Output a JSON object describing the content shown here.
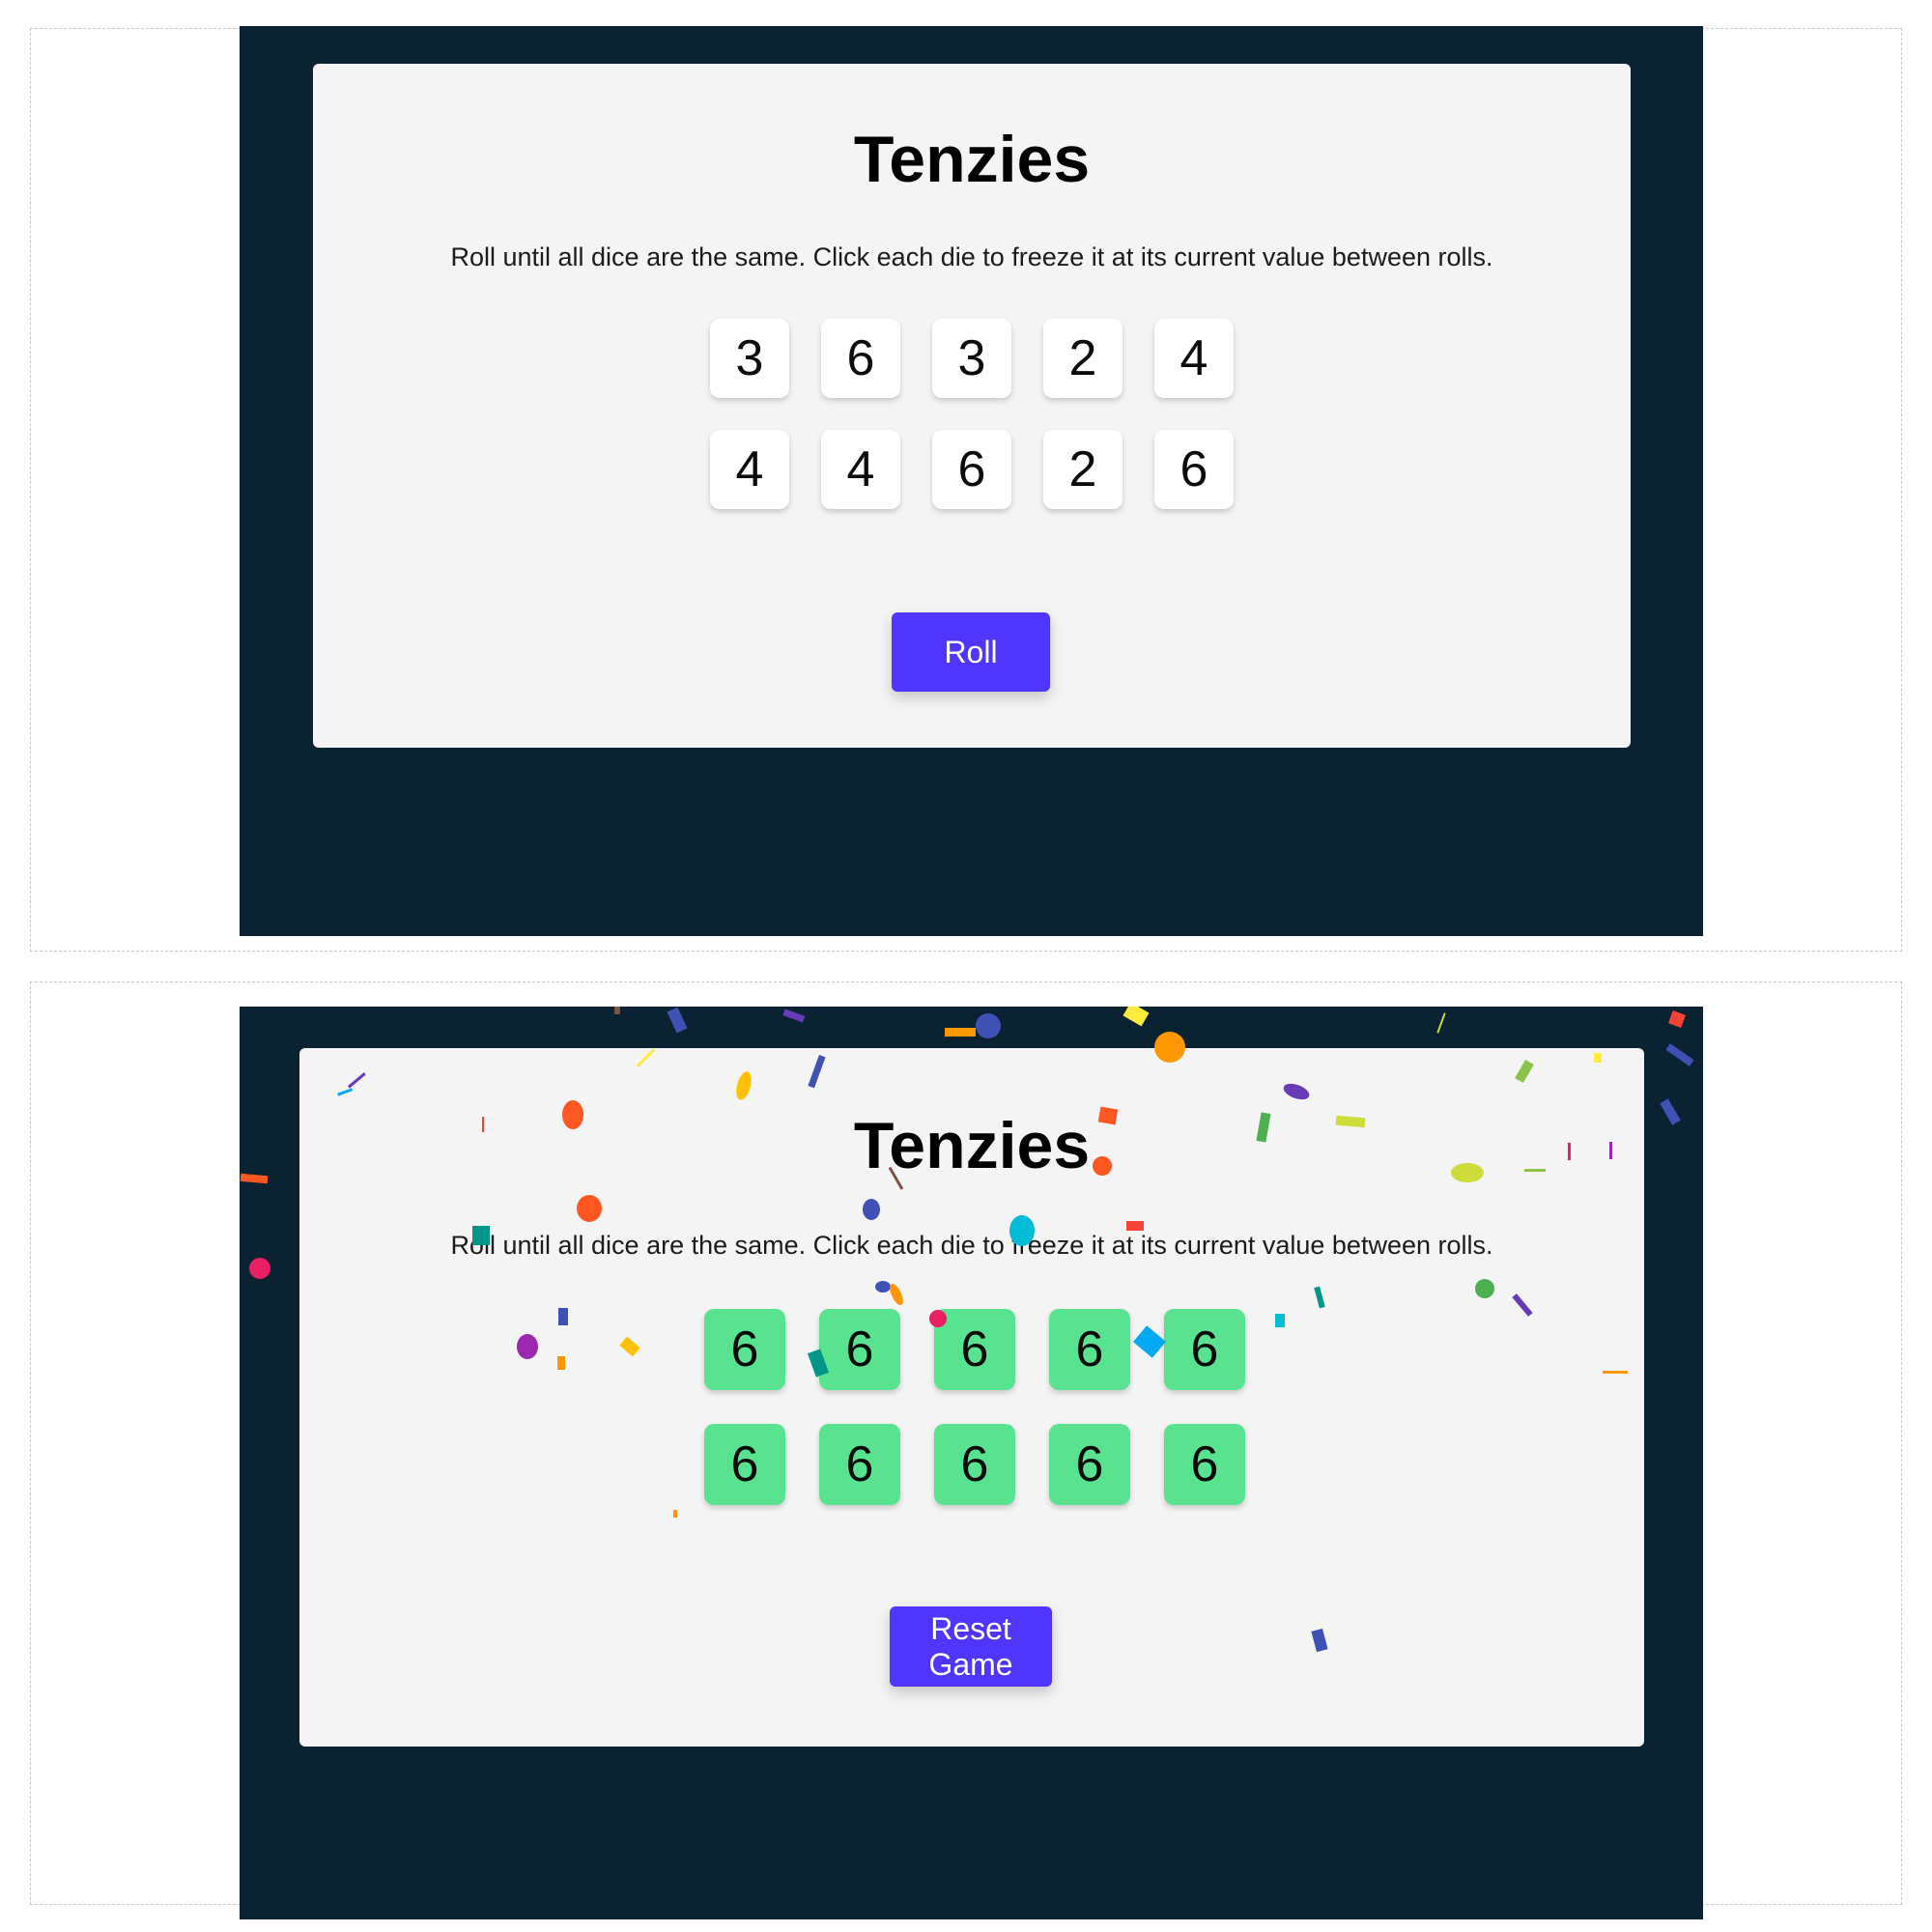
{
  "screens": [
    {
      "title": "Tenzies",
      "instructions": "Roll until all dice are the same. Click each die to freeze it at its current value between rolls.",
      "dice": [
        {
          "value": "3",
          "held": false
        },
        {
          "value": "6",
          "held": false
        },
        {
          "value": "3",
          "held": false
        },
        {
          "value": "2",
          "held": false
        },
        {
          "value": "4",
          "held": false
        },
        {
          "value": "4",
          "held": false
        },
        {
          "value": "4",
          "held": false
        },
        {
          "value": "6",
          "held": false
        },
        {
          "value": "2",
          "held": false
        },
        {
          "value": "6",
          "held": false
        }
      ],
      "button_label": "Roll",
      "confetti": false
    },
    {
      "title": "Tenzies",
      "instructions": "Roll until all dice are the same. Click each die to freeze it at its current value between rolls.",
      "dice": [
        {
          "value": "6",
          "held": true
        },
        {
          "value": "6",
          "held": true
        },
        {
          "value": "6",
          "held": true
        },
        {
          "value": "6",
          "held": true
        },
        {
          "value": "6",
          "held": true
        },
        {
          "value": "6",
          "held": true
        },
        {
          "value": "6",
          "held": true
        },
        {
          "value": "6",
          "held": true
        },
        {
          "value": "6",
          "held": true
        },
        {
          "value": "6",
          "held": true
        }
      ],
      "button_label": "Reset Game",
      "confetti": true
    }
  ],
  "colors": {
    "page_background": "#0b2233",
    "card_background": "#f4f4f4",
    "button": "#5035ff",
    "die_held": "#59e391",
    "die_default": "#ffffff"
  }
}
